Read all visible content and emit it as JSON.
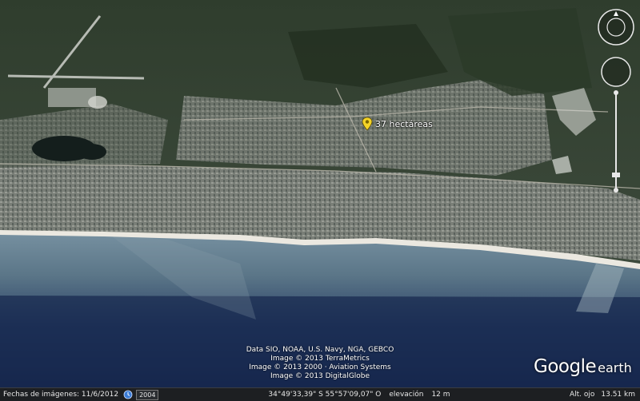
{
  "map": {
    "placemark_label": "37 hectáreas"
  },
  "attribution": {
    "lines": [
      "Data SIO, NOAA, U.S. Navy, NGA, GEBCO",
      "Image © 2013 TerraMetrics",
      "Image © 2013 2000 · Aviation Systems",
      "Image © 2013 DigitalGlobe"
    ]
  },
  "logo": {
    "google": "Google",
    "earth": "earth"
  },
  "status": {
    "imagery_dates": "Fechas de imágenes: 11/6/2012",
    "year": "2004",
    "coordinates": "34°49'33,39\" S   55°57'09,07\" O",
    "elevation_label": "elevación",
    "elevation_value": "12 m",
    "eye_alt_label": "Alt. ojo",
    "eye_alt_value": "13.51 km"
  },
  "colors": {
    "land": "#3a4a38",
    "town": "#8d918a",
    "beach": "#e9e6df",
    "ocean_near": "#6d8895",
    "ocean_far": "#1a2c52",
    "pin": "#f4d428"
  },
  "icons": {
    "placemark": "yellow-pushpin-icon",
    "historical": "clock-icon",
    "navigation": "look-compass-icon"
  }
}
